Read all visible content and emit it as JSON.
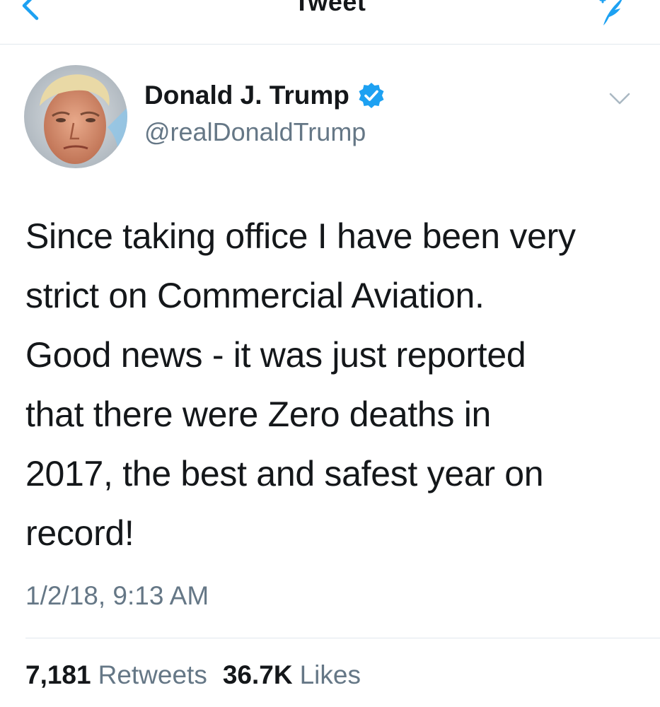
{
  "nav": {
    "title": "Tweet",
    "back_icon": "chevron-left-icon",
    "compose_icon": "compose-feather-icon"
  },
  "user": {
    "name": "Donald J. Trump",
    "handle": "@realDonaldTrump",
    "verified": true
  },
  "tweet": {
    "lines": [
      "Since taking office I have been very",
      "strict on Commercial Aviation.",
      "Good news - it was just reported",
      "that there were Zero deaths in",
      "2017, the best and safest year on",
      "record!"
    ],
    "timestamp": "1/2/18, 9:13 AM"
  },
  "stats": {
    "retweets_count": "7,181",
    "retweets_label": "Retweets",
    "likes_count": "36.7K",
    "likes_label": "Likes"
  },
  "colors": {
    "accent": "#1da1f2",
    "text_primary": "#14171a",
    "text_secondary": "#657786",
    "divider": "#e1e8ed"
  }
}
